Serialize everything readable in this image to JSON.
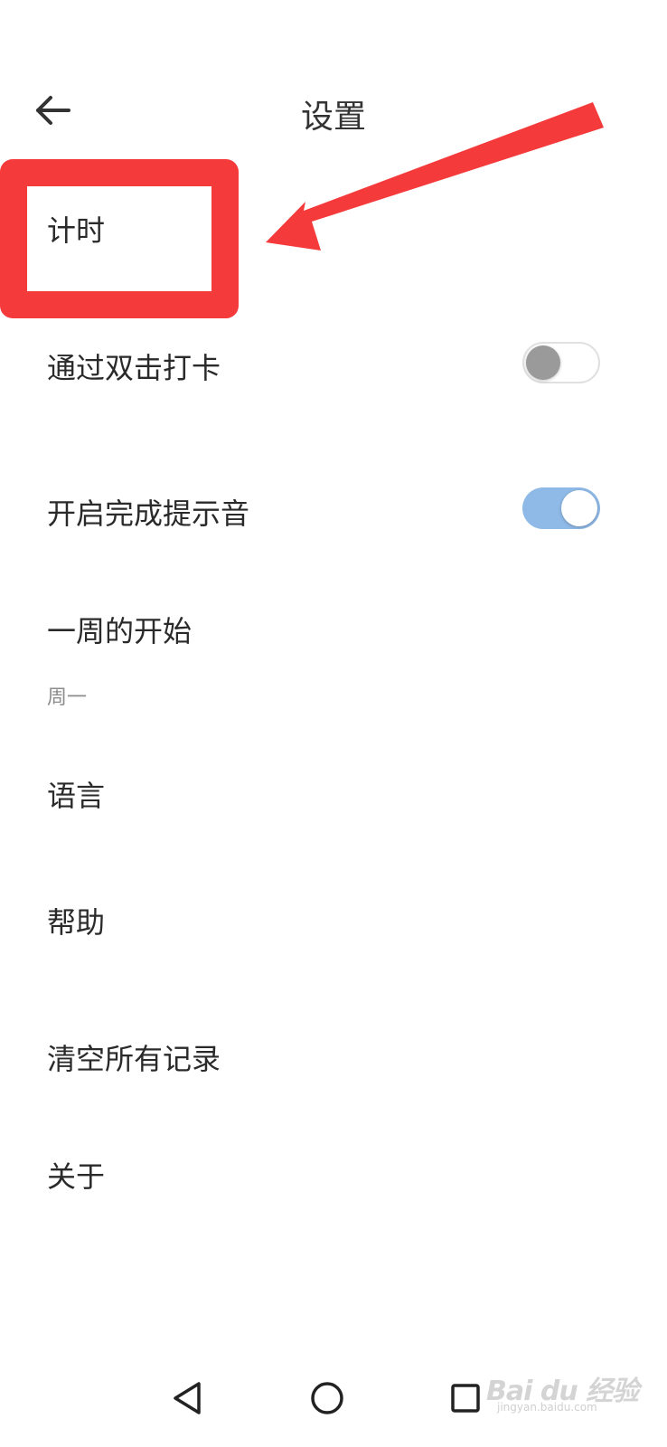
{
  "header": {
    "title": "设置",
    "back_icon": "arrow-left-icon"
  },
  "settings": {
    "timing": {
      "label": "计时"
    },
    "double_tap_checkin": {
      "label": "通过双击打卡",
      "toggle_on": false
    },
    "completion_sound": {
      "label": "开启完成提示音",
      "toggle_on": true
    },
    "week_start": {
      "label": "一周的开始",
      "value": "周一"
    },
    "language": {
      "label": "语言"
    },
    "help": {
      "label": "帮助"
    },
    "clear_records": {
      "label": "清空所有记录"
    },
    "about": {
      "label": "关于"
    }
  },
  "annotation": {
    "highlight_color": "#f43a3a"
  },
  "navbar": {
    "back_icon": "triangle-back-icon",
    "home_icon": "circle-home-icon",
    "recents_icon": "square-recents-icon"
  },
  "watermark": {
    "brand": "Bai du 经验",
    "url": "jingyan.baidu.com"
  },
  "colors": {
    "toggle_on": "#8fb9e6",
    "toggle_off_knob": "#9a9a9a"
  }
}
